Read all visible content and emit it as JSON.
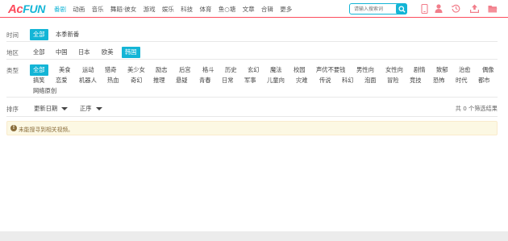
{
  "logo": {
    "part1": "Ac",
    "part2": "FUN"
  },
  "nav": [
    "番剧",
    "动画",
    "音乐",
    "舞蹈·彼女",
    "游戏",
    "娱乐",
    "科技",
    "体育",
    "鱼○塘",
    "文章",
    "合辑",
    "更多"
  ],
  "nav_active_index": 0,
  "search": {
    "placeholder": "请输入搜索词"
  },
  "header_icons": [
    "phone-icon",
    "user-icon",
    "history-icon",
    "upload-icon",
    "folder-icon"
  ],
  "colors": {
    "accent": "#14b5d6",
    "brand": "#fd4c5d",
    "header_icon": "#f17e8b"
  },
  "filters": {
    "time": {
      "label": "时间",
      "options": [
        "全部",
        "本季新番"
      ],
      "selected": 0
    },
    "region": {
      "label": "地区",
      "options": [
        "全部",
        "中国",
        "日本",
        "欧美",
        "韩国"
      ],
      "selected": 4
    },
    "type": {
      "label": "类型",
      "row1": [
        "全部",
        "美食",
        "运动",
        "猎奇",
        "美少女",
        "励志",
        "后宫",
        "格斗",
        "历史",
        "玄幻",
        "魔法",
        "校园",
        "声优不要钱",
        "男性向",
        "女性向",
        "剧情",
        "致郁",
        "治愈",
        "偶像"
      ],
      "row2": [
        "搞笑",
        "恋爱",
        "机器人",
        "热血",
        "奇幻",
        "推理",
        "悬疑",
        "青春",
        "日常",
        "军事",
        "儿童向",
        "灾难",
        "传说",
        "科幻",
        "泡面",
        "冒险",
        "竞技",
        "恐怖",
        "时代",
        "都市"
      ],
      "row3": [
        "网络原创"
      ],
      "selected": "全部"
    }
  },
  "sort": {
    "label": "排序",
    "by": "更新日期",
    "order": "正序",
    "result_count": "共 0 个筛选结果"
  },
  "notice": {
    "icon": "info-icon",
    "text": "未能搜寻到相关视频。"
  }
}
